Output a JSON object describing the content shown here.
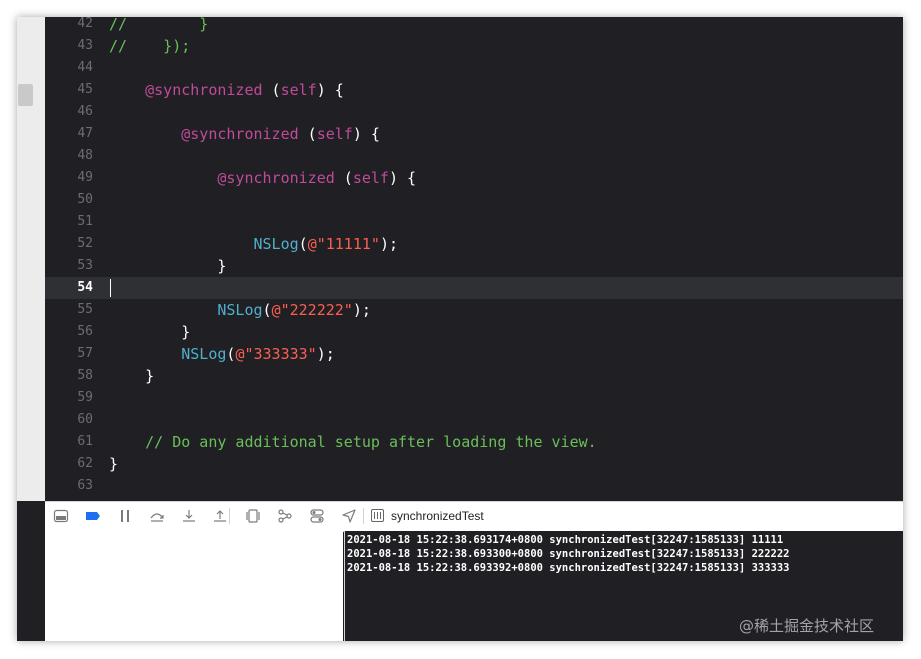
{
  "editor": {
    "current_line": "54",
    "lines": [
      {
        "number": "42",
        "tokens": [
          {
            "t": "//        }",
            "c": "comment"
          }
        ]
      },
      {
        "number": "43",
        "tokens": [
          {
            "t": "//    });",
            "c": "comment"
          }
        ]
      },
      {
        "number": "44",
        "tokens": []
      },
      {
        "number": "45",
        "tokens": [
          {
            "t": "    ",
            "c": "plain"
          },
          {
            "t": "@synchronized",
            "c": "directive"
          },
          {
            "t": " (",
            "c": "plain"
          },
          {
            "t": "self",
            "c": "keyword"
          },
          {
            "t": ") {",
            "c": "plain"
          }
        ]
      },
      {
        "number": "46",
        "tokens": []
      },
      {
        "number": "47",
        "tokens": [
          {
            "t": "        ",
            "c": "plain"
          },
          {
            "t": "@synchronized",
            "c": "directive"
          },
          {
            "t": " (",
            "c": "plain"
          },
          {
            "t": "self",
            "c": "keyword"
          },
          {
            "t": ") {",
            "c": "plain"
          }
        ]
      },
      {
        "number": "48",
        "tokens": []
      },
      {
        "number": "49",
        "tokens": [
          {
            "t": "            ",
            "c": "plain"
          },
          {
            "t": "@synchronized",
            "c": "directive"
          },
          {
            "t": " (",
            "c": "plain"
          },
          {
            "t": "self",
            "c": "keyword"
          },
          {
            "t": ") {",
            "c": "plain"
          }
        ]
      },
      {
        "number": "50",
        "tokens": []
      },
      {
        "number": "51",
        "tokens": []
      },
      {
        "number": "52",
        "tokens": [
          {
            "t": "                ",
            "c": "plain"
          },
          {
            "t": "NSLog",
            "c": "func"
          },
          {
            "t": "(",
            "c": "plain"
          },
          {
            "t": "@\"11111\"",
            "c": "string"
          },
          {
            "t": ");",
            "c": "plain"
          }
        ]
      },
      {
        "number": "53",
        "tokens": [
          {
            "t": "            }",
            "c": "plain"
          }
        ]
      },
      {
        "number": "54",
        "tokens": []
      },
      {
        "number": "55",
        "tokens": [
          {
            "t": "            ",
            "c": "plain"
          },
          {
            "t": "NSLog",
            "c": "func"
          },
          {
            "t": "(",
            "c": "plain"
          },
          {
            "t": "@\"222222\"",
            "c": "string"
          },
          {
            "t": ");",
            "c": "plain"
          }
        ]
      },
      {
        "number": "56",
        "tokens": [
          {
            "t": "        }",
            "c": "plain"
          }
        ]
      },
      {
        "number": "57",
        "tokens": [
          {
            "t": "        ",
            "c": "plain"
          },
          {
            "t": "NSLog",
            "c": "func"
          },
          {
            "t": "(",
            "c": "plain"
          },
          {
            "t": "@\"333333\"",
            "c": "string"
          },
          {
            "t": ");",
            "c": "plain"
          }
        ]
      },
      {
        "number": "58",
        "tokens": [
          {
            "t": "    }",
            "c": "plain"
          }
        ]
      },
      {
        "number": "59",
        "tokens": []
      },
      {
        "number": "60",
        "tokens": []
      },
      {
        "number": "61",
        "tokens": [
          {
            "t": "    ",
            "c": "plain"
          },
          {
            "t": "// Do any additional setup after loading the view.",
            "c": "comment"
          }
        ]
      },
      {
        "number": "62",
        "tokens": [
          {
            "t": "}",
            "c": "plain"
          }
        ]
      },
      {
        "number": "63",
        "tokens": []
      }
    ]
  },
  "debug_bar": {
    "buttons": [
      {
        "name": "hide-debug-area-icon",
        "icon": "panel"
      },
      {
        "name": "breakpoints-toggle-icon",
        "icon": "breakpoint"
      },
      {
        "name": "pause-continue-icon",
        "icon": "pause"
      },
      {
        "name": "step-over-icon",
        "icon": "step-over"
      },
      {
        "name": "step-into-icon",
        "icon": "step-into"
      },
      {
        "name": "step-out-icon",
        "icon": "step-out"
      },
      {
        "name": "debug-view-hierarchy-icon",
        "icon": "view-hierarchy"
      },
      {
        "name": "memory-graph-icon",
        "icon": "memory-graph"
      },
      {
        "name": "environment-overrides-icon",
        "icon": "toggles"
      },
      {
        "name": "simulate-location-icon",
        "icon": "location-arrow"
      }
    ],
    "scheme": "synchronizedTest"
  },
  "console": {
    "lines": [
      "2021-08-18 15:22:38.693174+0800 synchronizedTest[32247:1585133] 11111",
      "2021-08-18 15:22:38.693300+0800 synchronizedTest[32247:1585133] 222222",
      "2021-08-18 15:22:38.693392+0800 synchronizedTest[32247:1585133] 333333"
    ]
  },
  "watermark": "@稀土掘金技术社区",
  "colors": {
    "editor_bg": "#1f1f24",
    "current_line_bg": "#2f3036",
    "comment": "#6bbf59",
    "directive": "#c04b9a",
    "function": "#4eb0cc",
    "string": "#fc5f52",
    "line_number": "#6c6c75",
    "breakpoint_blue": "#1e6ff0"
  }
}
